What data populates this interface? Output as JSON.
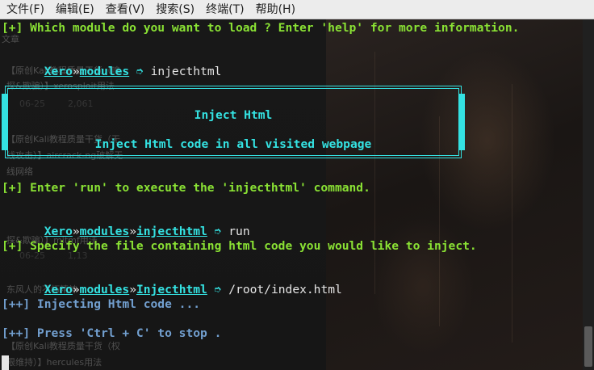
{
  "menubar": {
    "items": [
      "文件(F)",
      "编辑(E)",
      "查看(V)",
      "搜索(S)",
      "终端(T)",
      "帮助(H)"
    ]
  },
  "background_page": {
    "texts": [
      "文章",
      "【原创Kali教程质量干货（嗅",
      "探&欺骗）】xerosploit用法",
      "06-25",
      "2,061",
      "【原创Kali教程质量干货（无",
      "线攻击）】aircrack-ng破解无",
      "线网络",
      "探&欺骗）】mitmf用法",
      "06-25",
      "1,13",
      "东风人的不朽精神",
      "【原创Kali教程质量干货（权",
      "限维持）】hercules用法"
    ]
  },
  "terminal": {
    "line1": "[+] Which module do you want to load ? Enter 'help' for more information.",
    "prompt_user": "Xero",
    "prompt_sep": "»",
    "prompt_path": "modules",
    "prompt_arrow": "➮",
    "cmd1": "injecthtml",
    "banner_title": "Inject Html",
    "banner_desc": "Inject Html code in all visited webpage",
    "line_run_hint": "[+] Enter 'run' to execute the 'injecthtml' command.",
    "prompt_module": "injecthtml",
    "cmd2": "run",
    "line_specify": "[+] Specify the file containing html code you would like to inject.",
    "prompt_module2": "Injecthtml",
    "cmd3": "/root/index.html",
    "line_injecting": "[++] Injecting Html code ...",
    "line_stop": "[++] Press 'Ctrl + C' to stop ."
  }
}
